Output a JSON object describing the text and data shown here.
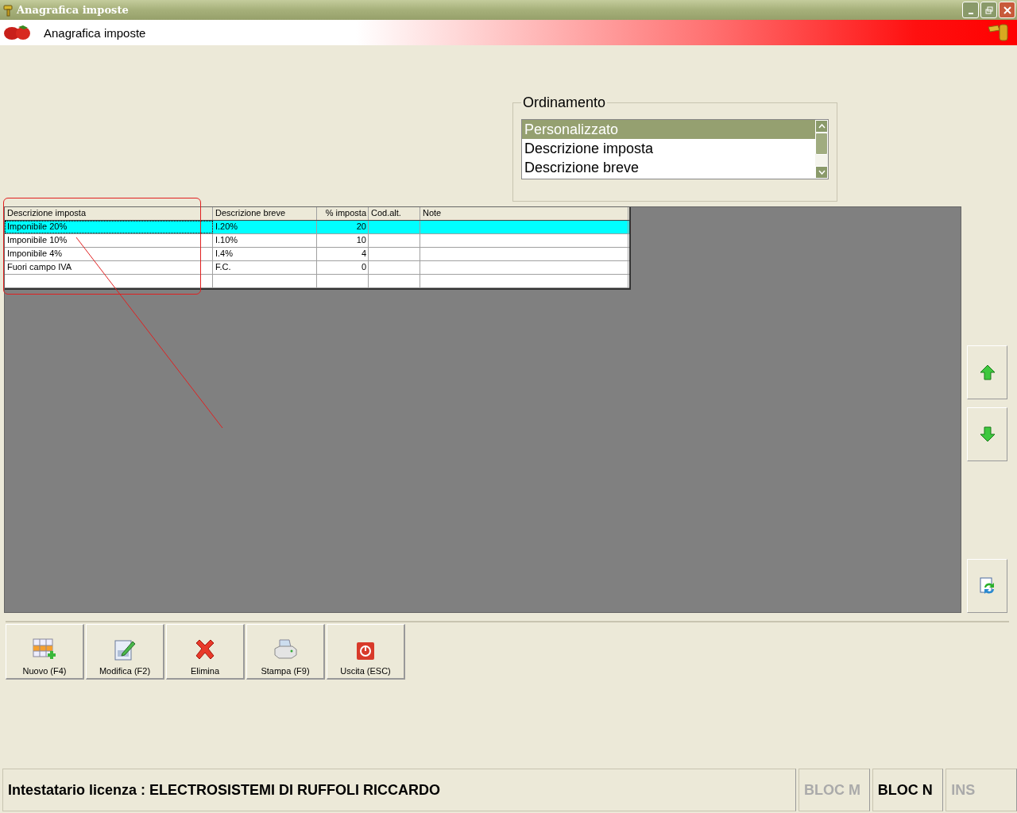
{
  "window": {
    "title": "Anagrafica imposte"
  },
  "header": {
    "title": "Anagrafica imposte"
  },
  "ordering": {
    "legend": "Ordinamento",
    "options": [
      {
        "label": "Personalizzato",
        "selected": true
      },
      {
        "label": "Descrizione imposta",
        "selected": false
      },
      {
        "label": "Descrizione breve",
        "selected": false
      }
    ]
  },
  "table": {
    "columns": [
      {
        "label": "Descrizione imposta"
      },
      {
        "label": "Descrizione breve"
      },
      {
        "label": "% imposta"
      },
      {
        "label": "Cod.alt."
      },
      {
        "label": "Note"
      }
    ],
    "rows": [
      {
        "cells": [
          "Imponibile 20%",
          "I.20%",
          "20",
          "",
          ""
        ],
        "selected": true
      },
      {
        "cells": [
          "Imponibile 10%",
          "I.10%",
          "10",
          "",
          ""
        ],
        "selected": false
      },
      {
        "cells": [
          "Imponibile 4%",
          "I.4%",
          "4",
          "",
          ""
        ],
        "selected": false
      },
      {
        "cells": [
          "Fuori campo IVA",
          "F.C.",
          "0",
          "",
          ""
        ],
        "selected": false
      }
    ]
  },
  "side_buttons": [
    {
      "kind": "up"
    },
    {
      "kind": "down"
    },
    {
      "kind": "refresh"
    }
  ],
  "toolbar": [
    {
      "label": "Nuovo (F4)",
      "kind": "new"
    },
    {
      "label": "Modifica (F2)",
      "kind": "edit"
    },
    {
      "label": "Elimina",
      "kind": "delete"
    },
    {
      "label": "Stampa (F9)",
      "kind": "print"
    },
    {
      "label": "Uscita (ESC)",
      "kind": "exit"
    }
  ],
  "status_bar": {
    "license": "Intestatario licenza : ELECTROSISTEMI DI RUFFOLI RICCARDO",
    "indicators": [
      {
        "label": "BLOC M",
        "on": false
      },
      {
        "label": "BLOC N",
        "on": true
      },
      {
        "label": "INS",
        "on": false
      }
    ]
  }
}
